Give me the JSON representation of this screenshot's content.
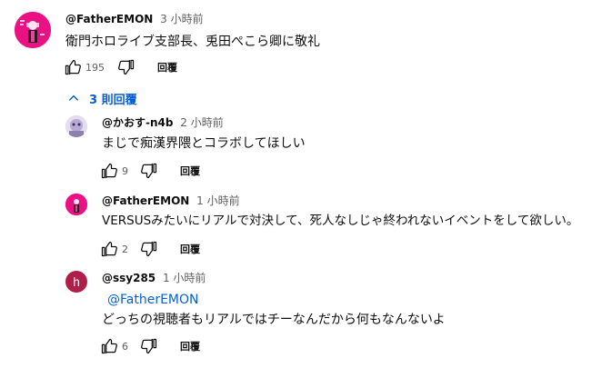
{
  "top_comment": {
    "author": "@FatherEMON",
    "time": "3 小時前",
    "text": "衛門ホロライブ支部長、兎田ぺこら卿に敬礼",
    "likes": "195",
    "reply_label": "回覆"
  },
  "replies_toggle": {
    "label": "3 則回覆"
  },
  "replies": [
    {
      "author": "@かおす-n4b",
      "time": "2 小時前",
      "text": "まじで痴漢界隈とコラボしてほしい",
      "likes": "9",
      "reply_label": "回覆"
    },
    {
      "author": "@FatherEMON",
      "time": "1 小時前",
      "text": "VERSUSみたいにリアルで対決して、死人なしじゃ終われないイベントをして欲しい。",
      "likes": "2",
      "reply_label": "回覆"
    },
    {
      "author": "@ssy285",
      "time": "1 小時前",
      "mention": "@FatherEMON",
      "text": "どっちの視聴者もリアルではチーなんだから何もなんないよ",
      "likes": "6",
      "reply_label": "回覆",
      "avatar_letter": "h"
    }
  ],
  "colors": {
    "link": "#065fd4",
    "secondary_text": "#606060",
    "avatar_pink": "#e8008c",
    "avatar_h": "#b01f4a"
  }
}
